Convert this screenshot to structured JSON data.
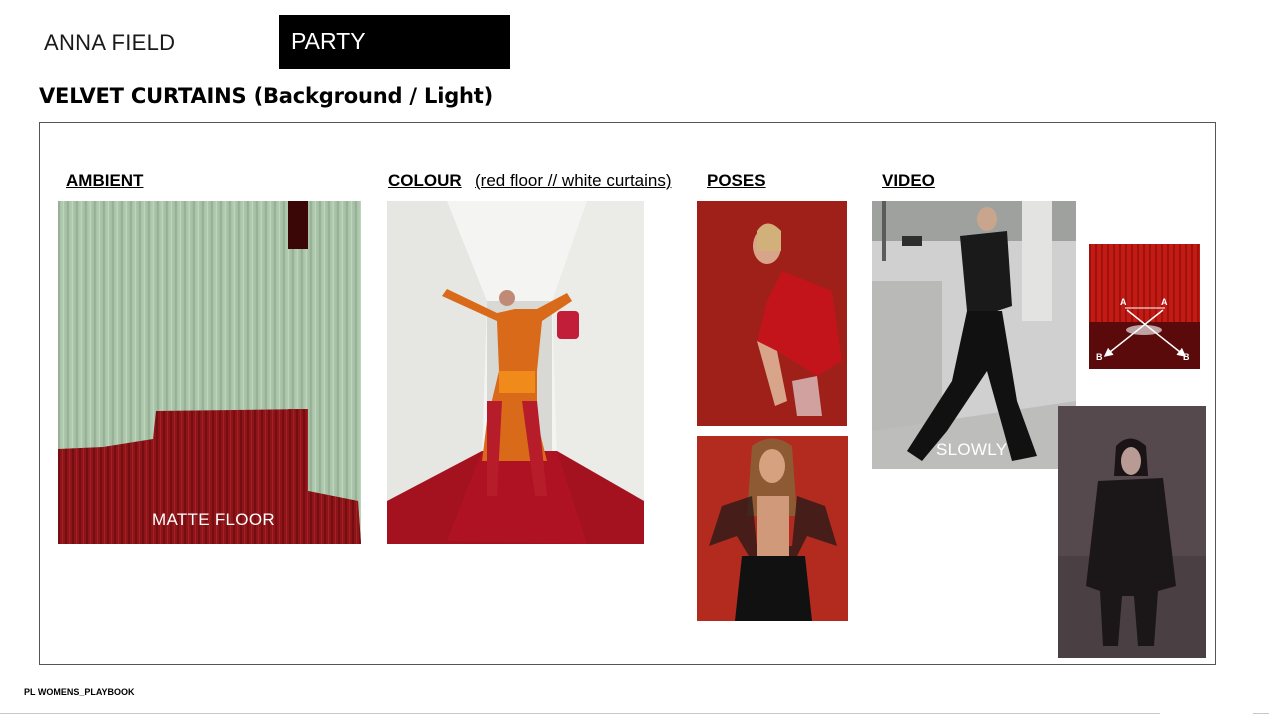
{
  "header": {
    "brand": "ANNA FIELD",
    "tag": "PARTY"
  },
  "section": {
    "title": "VELVET CURTAINS (Background / Light)"
  },
  "columns": {
    "ambient": "AMBIENT",
    "colour": "COLOUR",
    "colour_note": "(red floor // white curtains)",
    "poses": "POSES",
    "video": "VIDEO"
  },
  "captions": {
    "matte_floor": "MATTE FLOOR",
    "slowly": "SLOWLY"
  },
  "diagram": {
    "label_a1": "A",
    "label_a2": "A",
    "label_b1": "B",
    "label_b2": "B"
  },
  "footer": {
    "text": "PL WOMENS_PLAYBOOK"
  },
  "colors": {
    "curtain_red": "#8e1418",
    "curtain_green": "#a9c2a8",
    "tag_bg": "#000000",
    "pose_bg": "#a8241c"
  }
}
